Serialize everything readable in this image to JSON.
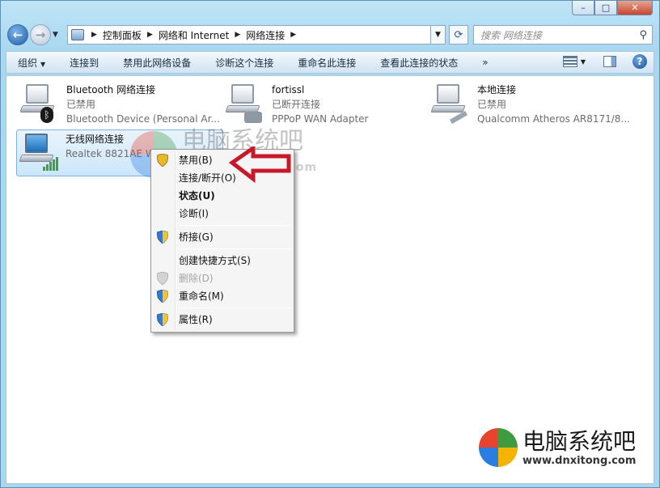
{
  "window": {
    "caption_buttons": [
      "–",
      "□",
      "✕"
    ]
  },
  "address_bar": {
    "crumbs": [
      "控制面板",
      "网络和 Internet",
      "网络连接"
    ],
    "search_placeholder": "搜索 网络连接"
  },
  "command_bar": {
    "items": [
      "组织",
      "连接到",
      "禁用此网络设备",
      "诊断这个连接",
      "重命名此连接",
      "查看此连接的状态",
      "»"
    ]
  },
  "connections": [
    {
      "name": "Bluetooth 网络连接",
      "status": "已禁用",
      "device": "Bluetooth Device (Personal Ar..."
    },
    {
      "name": "fortissl",
      "status": "已断开连接",
      "device": "PPPoP WAN Adapter"
    },
    {
      "name": "本地连接",
      "status": "已禁用",
      "device": "Qualcomm Atheros AR8171/8..."
    },
    {
      "name": "无线网络连接",
      "status": "",
      "device": "Realtek 8821AE W..."
    }
  ],
  "context_menu": {
    "items": [
      {
        "label": "禁用(B)",
        "shield": true
      },
      {
        "label": "连接/断开(O)"
      },
      {
        "label": "状态(U)",
        "bold": true
      },
      {
        "label": "诊断(I)"
      },
      {
        "label": "桥接(G)",
        "shield": true
      },
      {
        "label": "创建快捷方式(S)"
      },
      {
        "label": "删除(D)",
        "shield": true,
        "disabled": true
      },
      {
        "label": "重命名(M)",
        "shield": true
      },
      {
        "label": "属性(R)",
        "shield": true
      }
    ]
  },
  "watermark": {
    "name": "电脑系统吧",
    "url": "www.dnxitong.com"
  },
  "colors": {
    "arrow": "#c8192b",
    "selection": "#cde6fb"
  }
}
